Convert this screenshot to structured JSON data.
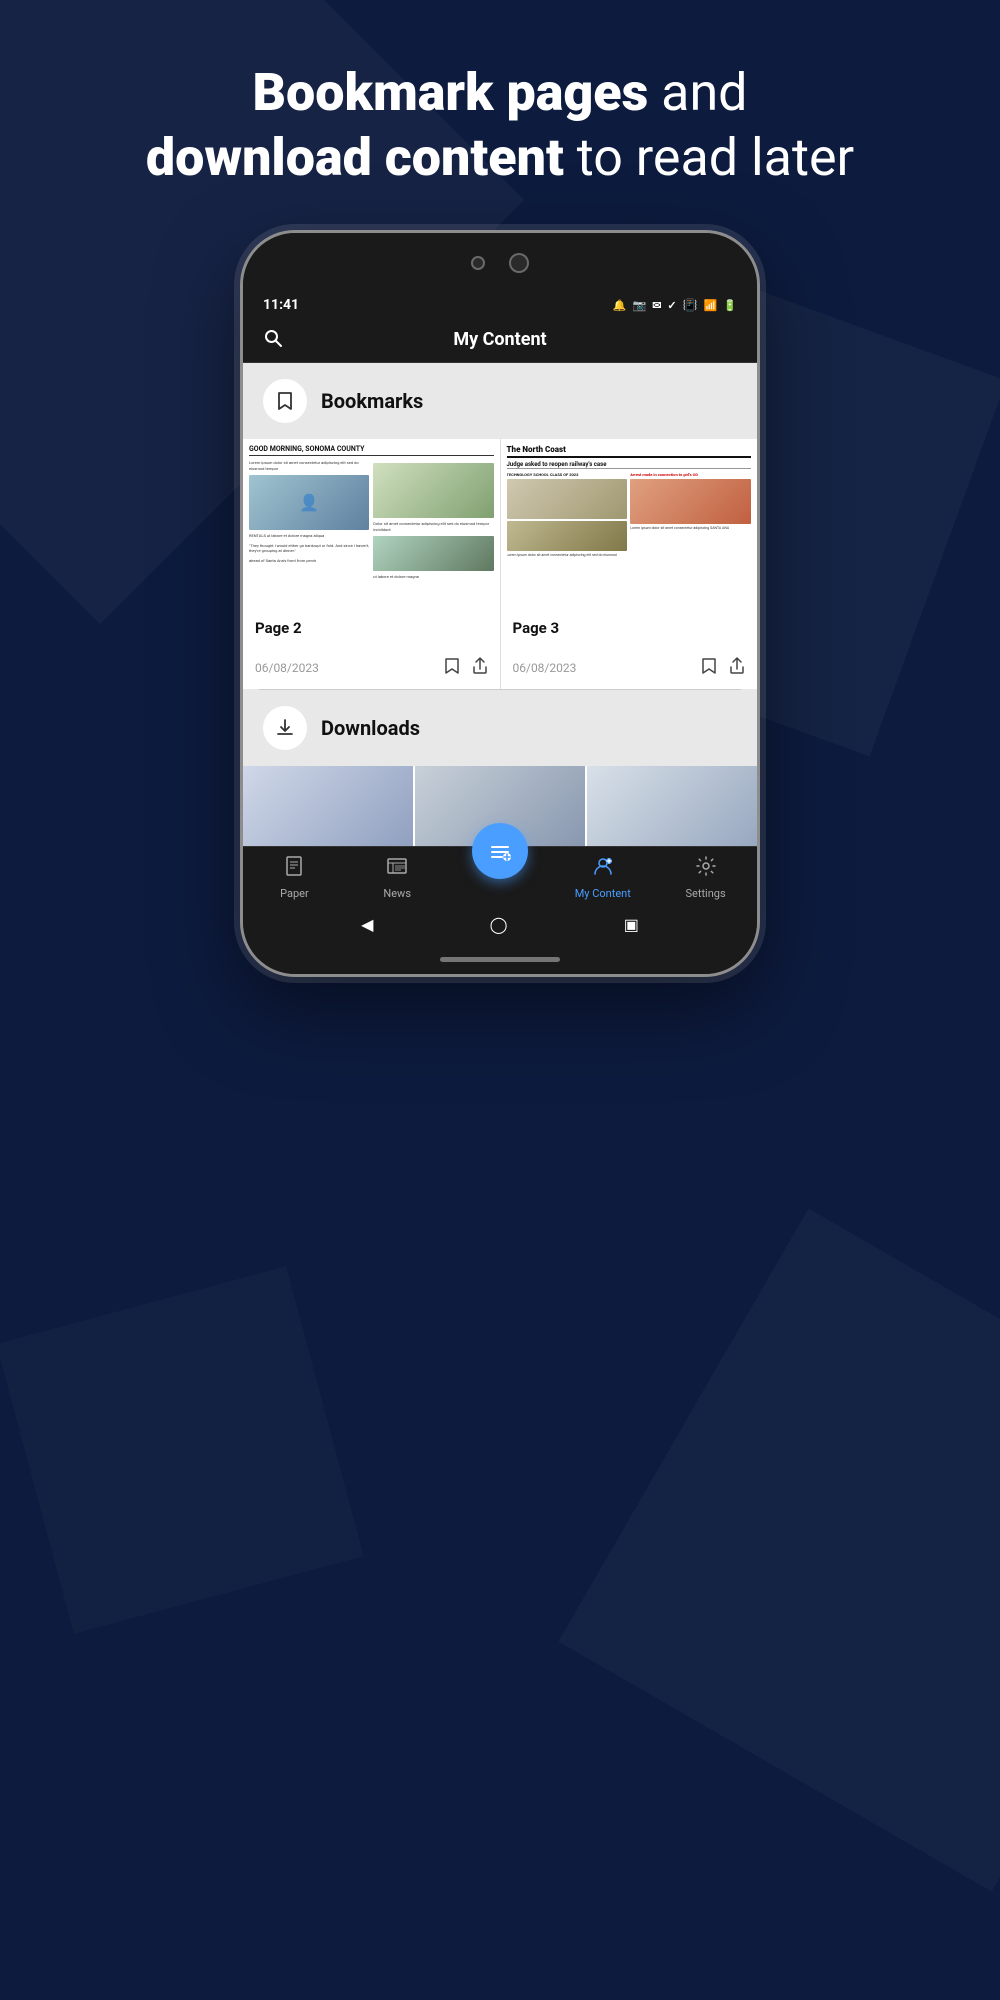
{
  "headline": {
    "part1": "Bookmark pages",
    "connector1": " and",
    "part2": "download content",
    "connector2": " to read later"
  },
  "status_bar": {
    "time": "11:41",
    "icons": "🔔 📷 ✉ ✓"
  },
  "app_header": {
    "title": "My Content",
    "search_label": "search"
  },
  "bookmarks_section": {
    "title": "Bookmarks",
    "icon": "🔖"
  },
  "cards": [
    {
      "id": "card-page2",
      "page_label": "Page 2",
      "date": "06/08/2023"
    },
    {
      "id": "card-page3",
      "page_label": "Page 3",
      "date": "06/08/2023"
    }
  ],
  "downloads_section": {
    "title": "Downloads",
    "icon": "⬇"
  },
  "bottom_nav": {
    "items": [
      {
        "id": "paper",
        "label": "Paper",
        "icon": "📄",
        "active": false
      },
      {
        "id": "news",
        "label": "News",
        "icon": "📰",
        "active": false
      },
      {
        "id": "my-content",
        "label": "My Content",
        "icon": "👤",
        "active": true
      },
      {
        "id": "settings",
        "label": "Settings",
        "icon": "⚙",
        "active": false
      }
    ],
    "fab_icon": "≡+"
  }
}
